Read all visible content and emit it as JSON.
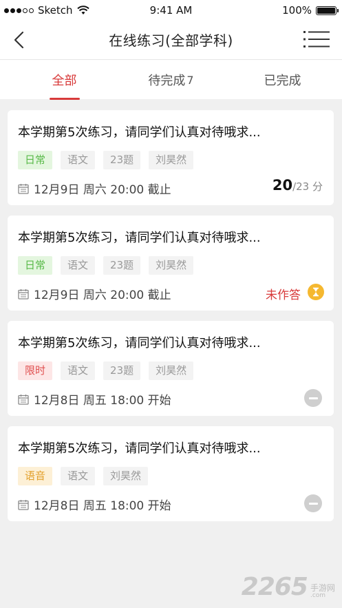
{
  "status_bar": {
    "carrier": "Sketch",
    "time": "9:41 AM",
    "battery": "100%"
  },
  "nav": {
    "title": "在线练习(全部学科)"
  },
  "tabs": [
    {
      "label": "全部",
      "count": ""
    },
    {
      "label": "待完成",
      "count": "7"
    },
    {
      "label": "已完成",
      "count": ""
    }
  ],
  "cards": [
    {
      "title": "本学期第5次练习，请同学们认真对待哦求...",
      "tags": [
        "日常",
        "语文",
        "23题",
        "刘昊然"
      ],
      "date": "12月9日 周六 20:00 截止",
      "score": "20",
      "score_total": "/23 分"
    },
    {
      "title": "本学期第5次练习，请同学们认真对待哦求...",
      "tags": [
        "日常",
        "语文",
        "23题",
        "刘昊然"
      ],
      "date": "12月9日 周六 20:00 截止",
      "status": "未作答"
    },
    {
      "title": "本学期第5次练习，请同学们认真对待哦求...",
      "tags": [
        "限时",
        "语文",
        "23题",
        "刘昊然"
      ],
      "date": "12月8日 周五 18:00 开始"
    },
    {
      "title": "本学期第5次练习，请同学们认真对待哦求...",
      "tags": [
        "语音",
        "语文",
        "刘昊然"
      ],
      "date": "12月8日 周五 18:00 开始"
    }
  ],
  "watermark": {
    "logo": "2265",
    "cn": "手游网",
    "url": ".com"
  },
  "colors": {
    "accent": "#d83a3a",
    "daily": "#58b948",
    "timed": "#e05050",
    "voice": "#e2a02c",
    "hourglass": "#f5b830"
  }
}
